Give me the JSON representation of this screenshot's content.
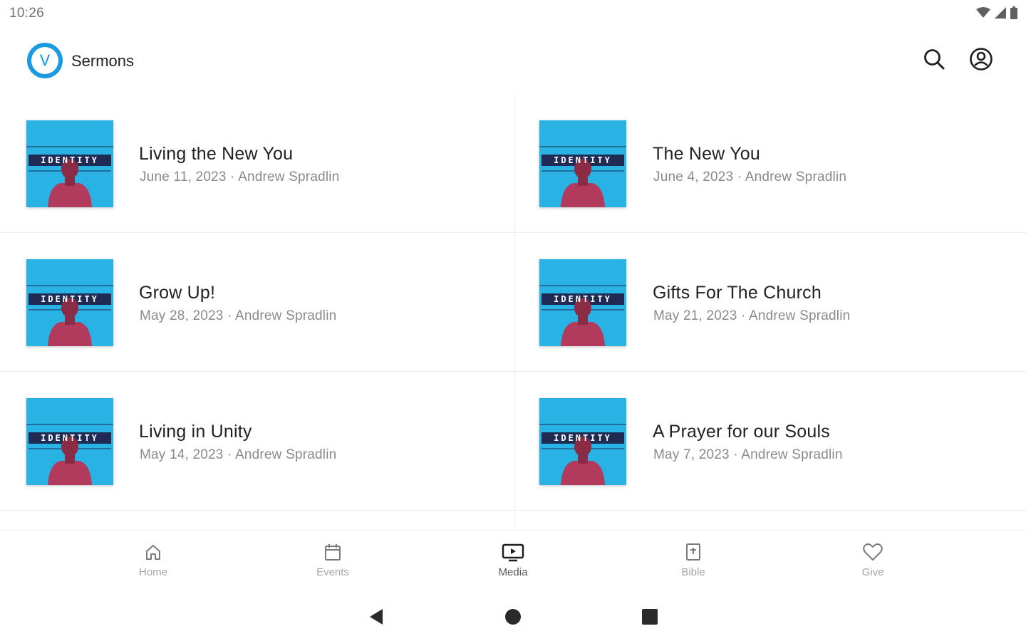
{
  "status_bar": {
    "time": "10:26"
  },
  "app_bar": {
    "logo_letter": "V",
    "title": "Sermons"
  },
  "thumbnail": {
    "title_text": "IDENTITY",
    "background": "#29b2e4",
    "banner_color": "#1f2a55",
    "figure_color": "#b23a5c"
  },
  "sermons": [
    {
      "title": "Living the New You",
      "subtitle": "June 11, 2023 · Andrew Spradlin"
    },
    {
      "title": "The New You",
      "subtitle": "June 4, 2023 · Andrew Spradlin"
    },
    {
      "title": "Grow Up!",
      "subtitle": "May 28, 2023 · Andrew Spradlin"
    },
    {
      "title": "Gifts For The Church",
      "subtitle": "May 21, 2023 · Andrew Spradlin"
    },
    {
      "title": "Living in Unity",
      "subtitle": "May 14, 2023 · Andrew Spradlin"
    },
    {
      "title": "A Prayer for our Souls",
      "subtitle": "May 7, 2023 · Andrew Spradlin"
    }
  ],
  "bottom_nav": [
    {
      "label": "Home",
      "icon": "home-icon"
    },
    {
      "label": "Events",
      "icon": "calendar-icon"
    },
    {
      "label": "Media",
      "icon": "media-icon",
      "active": true
    },
    {
      "label": "Bible",
      "icon": "bible-icon"
    },
    {
      "label": "Give",
      "icon": "heart-icon"
    }
  ],
  "colors": {
    "accent": "#1a9be0",
    "text_primary": "#222222",
    "text_secondary": "#8a8a8a",
    "nav_inactive": "#a5a5a5"
  }
}
